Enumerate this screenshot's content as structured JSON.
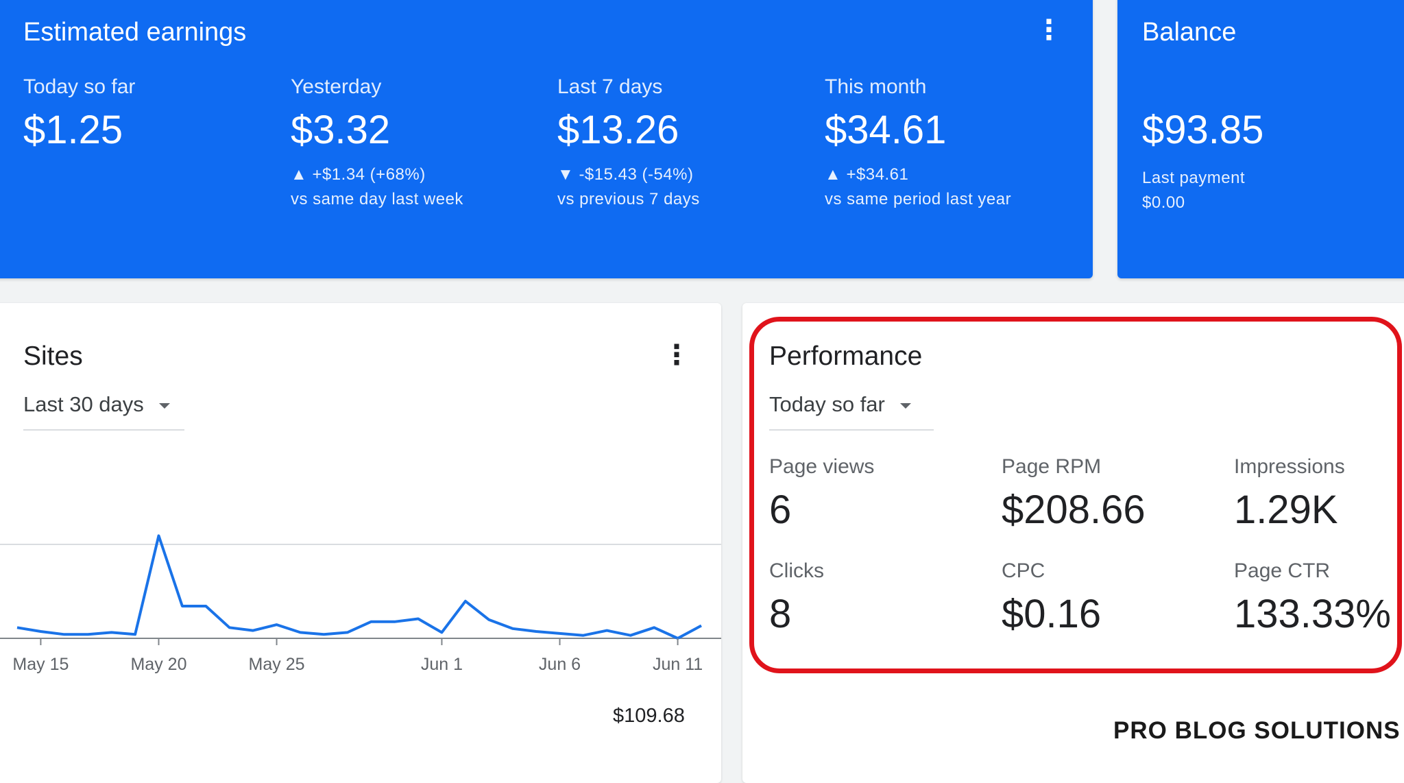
{
  "earnings": {
    "title": "Estimated earnings",
    "metrics": [
      {
        "label": "Today so far",
        "value": "$1.25",
        "delta": "",
        "compare": ""
      },
      {
        "label": "Yesterday",
        "value": "$3.32",
        "arrow": "▲",
        "delta": "+$1.34 (+68%)",
        "compare": "vs same day last week"
      },
      {
        "label": "Last 7 days",
        "value": "$13.26",
        "arrow": "▼",
        "delta": "-$15.43 (-54%)",
        "compare": "vs previous 7 days"
      },
      {
        "label": "This month",
        "value": "$34.61",
        "arrow": "▲",
        "delta": "+$34.61",
        "compare": "vs same period last year"
      }
    ]
  },
  "balance": {
    "title": "Balance",
    "value": "$93.85",
    "last_payment_label": "Last payment",
    "last_payment_value": "$0.00"
  },
  "sites": {
    "title": "Sites",
    "range": "Last 30 days",
    "total": "$109.68"
  },
  "performance": {
    "title": "Performance",
    "range": "Today so far",
    "metrics": [
      {
        "label": "Page views",
        "value": "6"
      },
      {
        "label": "Page RPM",
        "value": "$208.66"
      },
      {
        "label": "Impressions",
        "value": "1.29K"
      },
      {
        "label": "Clicks",
        "value": "8"
      },
      {
        "label": "CPC",
        "value": "$0.16"
      },
      {
        "label": "Page CTR",
        "value": "133.33%"
      }
    ]
  },
  "watermark": "PRO BLOG SOLUTIONS",
  "chart_data": {
    "type": "line",
    "x_tick_labels": [
      "May 15",
      "May 20",
      "May 25",
      "Jun 1",
      "Jun 6",
      "Jun 11"
    ],
    "x": [
      "May 14",
      "May 15",
      "May 16",
      "May 17",
      "May 18",
      "May 19",
      "May 20",
      "May 21",
      "May 22",
      "May 23",
      "May 24",
      "May 25",
      "May 26",
      "May 27",
      "May 28",
      "May 29",
      "May 30",
      "May 31",
      "Jun 1",
      "Jun 2",
      "Jun 3",
      "Jun 4",
      "Jun 5",
      "Jun 6",
      "Jun 7",
      "Jun 8",
      "Jun 9",
      "Jun 10",
      "Jun 11",
      "Jun 12"
    ],
    "series": [
      {
        "color": "#1a73e8",
        "values": [
          1.1,
          0.7,
          0.4,
          0.4,
          0.6,
          0.4,
          10.5,
          3.3,
          3.3,
          1.1,
          0.8,
          1.4,
          0.6,
          0.4,
          0.6,
          1.7,
          1.7,
          2.0,
          0.6,
          3.8,
          1.9,
          1.0,
          0.7,
          0.5,
          0.3,
          0.8,
          0.3,
          1.1,
          0.0,
          1.3
        ]
      }
    ],
    "total_label": "$109.68",
    "grid": true
  },
  "colors": {
    "accent": "#0f6bf2",
    "line": "#1a73e8",
    "highlight": "#e0131b"
  }
}
